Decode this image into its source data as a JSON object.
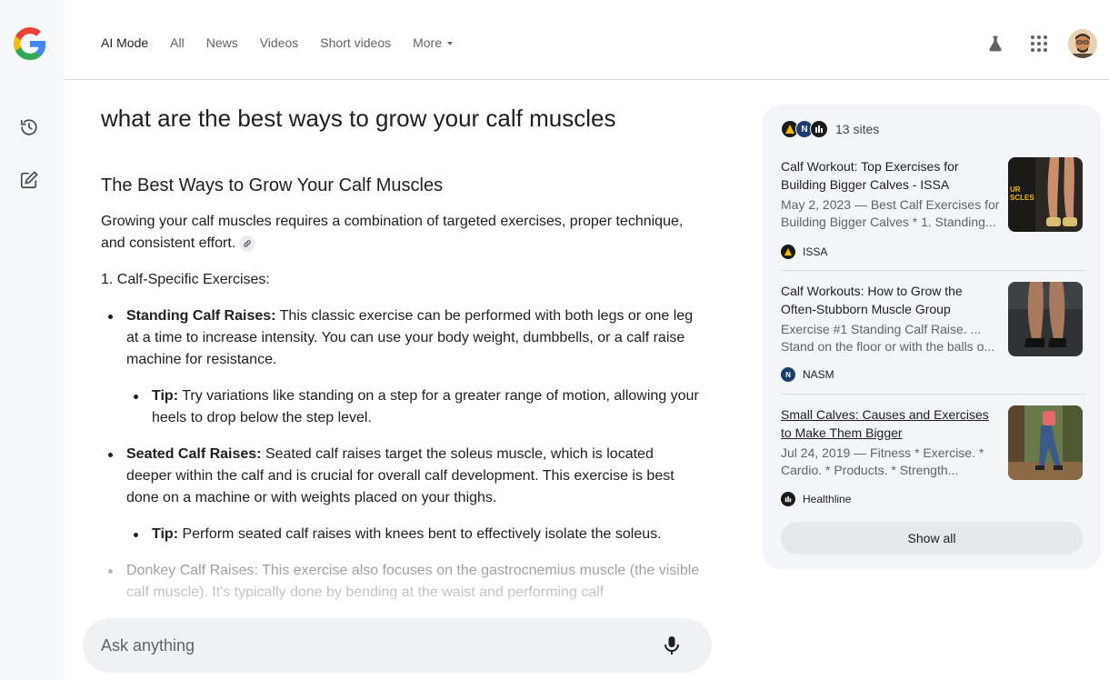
{
  "nav": {
    "tabs": [
      {
        "label": "AI Mode"
      },
      {
        "label": "All"
      },
      {
        "label": "News"
      },
      {
        "label": "Videos"
      },
      {
        "label": "Short videos"
      },
      {
        "label": "More"
      }
    ]
  },
  "query": "what are the best ways to grow your calf muscles",
  "answer": {
    "heading": "The Best Ways to Grow Your Calf Muscles",
    "intro": "Growing your calf muscles requires a combination of targeted exercises, proper technique, and consistent effort.",
    "section1": "1. Calf-Specific Exercises:",
    "items": [
      {
        "title": "Standing Calf Raises:",
        "text": " This classic exercise can be performed with both legs or one leg at a time to increase intensity. You can use your body weight, dumbbells, or a calf raise machine for resistance.",
        "tip_label": "Tip:",
        "tip_text": " Try variations like standing on a step for a greater range of motion, allowing your heels to drop below the step level."
      },
      {
        "title": "Seated Calf Raises:",
        "text": " Seated calf raises target the soleus muscle, which is located deeper within the calf and is crucial for overall calf development. This exercise is best done on a machine or with weights placed on your thighs.",
        "tip_label": "Tip:",
        "tip_text": " Perform seated calf raises with knees bent to effectively isolate the soleus."
      },
      {
        "title": "Donkey Calf Raises:",
        "text": " This exercise also focuses on the gastrocnemius muscle (the visible calf muscle). It's typically done by bending at the waist and performing calf"
      }
    ]
  },
  "ask": {
    "placeholder": "Ask anything"
  },
  "sources": {
    "count_label": "13 sites",
    "cards": [
      {
        "title": "Calf Workout: Top Exercises for Building Bigger Calves - ISSA",
        "snippet": "May 2, 2023 — Best Calf Exercises for Building Bigger Calves * 1. Standing...",
        "source": "ISSA",
        "thumb_text": "UR\nSCLES"
      },
      {
        "title": "Calf Workouts: How to Grow the Often-Stubborn Muscle Group",
        "snippet": "Exercise #1 Standing Calf Raise. ... Stand on the floor or with the balls o...",
        "source": "NASM"
      },
      {
        "title": "Small Calves: Causes and Exercises to Make Them Bigger",
        "snippet": "Jul 24, 2019 — Fitness * Exercise. * Cardio. * Products. * Strength...",
        "source": "Healthline"
      }
    ],
    "show_all": "Show all"
  },
  "colors": {
    "brand_blue": "#4285F4",
    "brand_red": "#EA4335",
    "brand_yellow": "#FBBC05",
    "brand_green": "#34A853"
  }
}
